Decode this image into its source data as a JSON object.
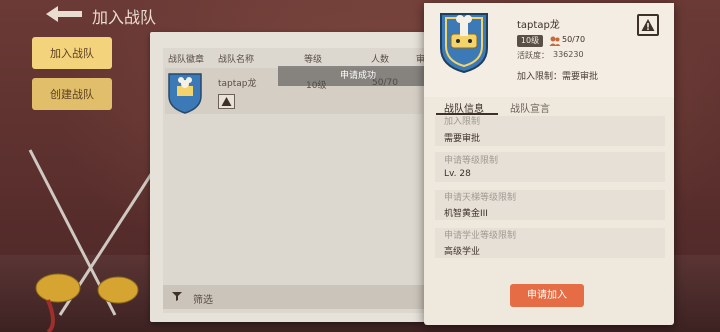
{
  "header": {
    "title": "加入战队"
  },
  "tabs": [
    {
      "label": "加入战队",
      "active": true
    },
    {
      "label": "创建战队",
      "active": false
    }
  ],
  "list": {
    "columns": [
      "战队徽章",
      "战队名称",
      "等级",
      "人数",
      "审"
    ],
    "rows": [
      {
        "name": "taptap龙",
        "level": "10级",
        "members": "50/70"
      }
    ],
    "filter_label": "筛选",
    "toast": "申请成功"
  },
  "team_card": {
    "name": "taptap龙",
    "level": "10级",
    "members": "50/70",
    "activity_label": "活跃度：",
    "activity_value": "336230",
    "join_restriction_label": "加入限制：",
    "join_restriction_value": "需要审批",
    "tabs": [
      "战队信息",
      "战队宣言"
    ],
    "sections": [
      {
        "label": "加入限制",
        "value": "需要审批"
      },
      {
        "label": "申请等级限制",
        "value": "Lv. 28"
      },
      {
        "label": "申请天梯等级限制",
        "value": "机智黄金III"
      },
      {
        "label": "申请学业等级限制",
        "value": "高级学业"
      }
    ],
    "apply_button": "申请加入"
  },
  "colors": {
    "accent": "#e56c44",
    "tab_active": "#f4d37d",
    "paper": "#efe8dd",
    "emblem_blue": "#3b7ab6"
  }
}
